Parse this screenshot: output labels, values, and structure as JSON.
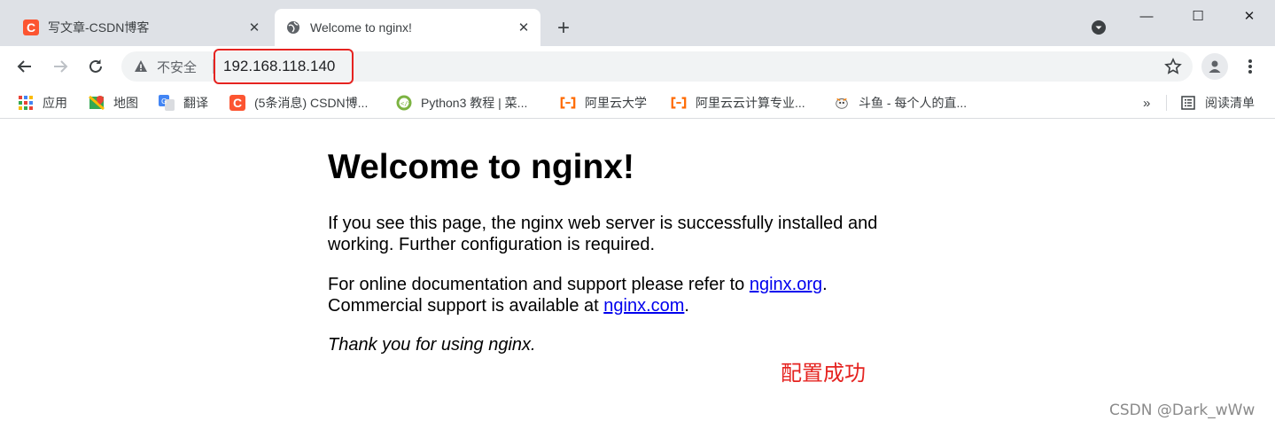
{
  "tabs": [
    {
      "title": "写文章-CSDN博客",
      "favicon": "csdn-icon",
      "active": false,
      "close": "✕"
    },
    {
      "title": "Welcome to nginx!",
      "favicon": "globe-icon",
      "active": true,
      "close": "✕"
    }
  ],
  "new_tab_symbol": "+",
  "window_controls": {
    "minimize": "—",
    "maximize": "☐",
    "close": "✕"
  },
  "toolbar": {
    "security_label": "不安全",
    "url": "192.168.118.140"
  },
  "bookmarks": [
    {
      "label": "应用",
      "icon": "apps-grid-icon"
    },
    {
      "label": "地图",
      "icon": "maps-icon"
    },
    {
      "label": "翻译",
      "icon": "translate-icon"
    },
    {
      "label": "(5条消息) CSDN博...",
      "icon": "csdn-icon"
    },
    {
      "label": "Python3 教程 | 菜...",
      "icon": "runoob-icon"
    },
    {
      "label": "阿里云大学",
      "icon": "aliyun-icon"
    },
    {
      "label": "阿里云云计算专业...",
      "icon": "aliyun-icon"
    },
    {
      "label": "斗鱼 - 每个人的直...",
      "icon": "douyu-icon"
    }
  ],
  "bookmarks_more": "»",
  "reading_list_label": "阅读清单",
  "page": {
    "heading": "Welcome to nginx!",
    "para1_line1": "If you see this page, the nginx web server is successfully installed and",
    "para1_line2": "working. Further configuration is required.",
    "para2_line1_text": "For online documentation and support please refer to ",
    "para2_link1": "nginx.org",
    "para2_line1_end": ".",
    "para2_line2_text": "Commercial support is available at ",
    "para2_link2": "nginx.com",
    "para2_line2_end": ".",
    "para3": "Thank you for using nginx."
  },
  "annotation": "配置成功",
  "watermark": "CSDN @Dark_wWw",
  "colors": {
    "tabstrip_bg": "#dee1e6",
    "omnibox_bg": "#f1f3f4",
    "highlight_red": "#e52320",
    "link_blue": "#0000ee",
    "csdn_orange": "#fc5531",
    "aliyun_orange": "#ff6a00"
  }
}
